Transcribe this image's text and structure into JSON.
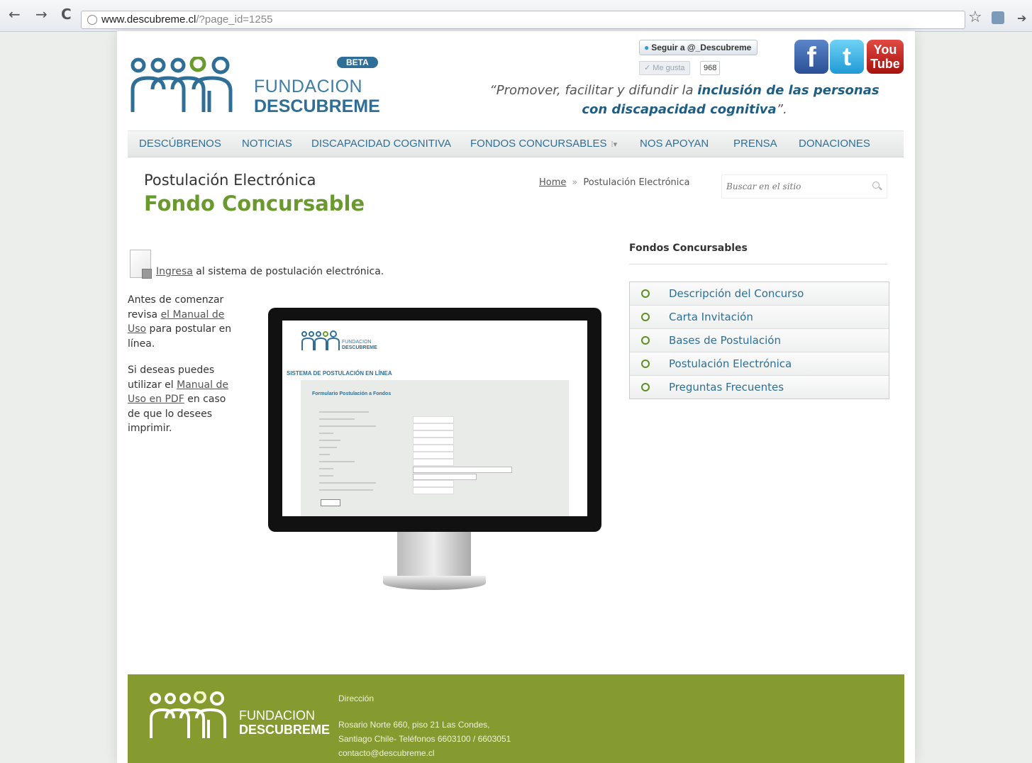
{
  "browser": {
    "url_host": "www.descubreme.cl",
    "url_path": "/?page_id=1255"
  },
  "header": {
    "logo_word1": "FUNDACION",
    "logo_word2": "DESCUBREME",
    "beta_badge": "BETA",
    "twitter_follow": "Seguir a @_Descubreme",
    "facebook_like": "Me gusta",
    "facebook_count": "968",
    "youtube_top": "You",
    "youtube_bottom": "Tube",
    "tagline_part1": "“Promover, facilitar y difundir la ",
    "tagline_highlight1": "inclusión de las personas",
    "tagline_highlight2": "con discapacidad cognitiva",
    "tagline_end": "”."
  },
  "menu": [
    {
      "label": "DESCÚBRENOS"
    },
    {
      "label": "NOTICIAS"
    },
    {
      "label": "DISCAPACIDAD COGNITIVA"
    },
    {
      "label": "FONDOS CONCURSABLES"
    },
    {
      "label": "NOS APOYAN"
    },
    {
      "label": "PRENSA"
    },
    {
      "label": "DONACIONES"
    }
  ],
  "page": {
    "title_line1": "Postulación Electrónica",
    "title_line2": "Fondo Concursable",
    "breadcrumb_home": "Home",
    "breadcrumb_sep": "»",
    "breadcrumb_current": "Postulación Electrónica",
    "search_placeholder": "Buscar en el sitio"
  },
  "content": {
    "ingresa_link": "Ingresa",
    "ingresa_rest": " al sistema de postulación electrónica.",
    "p1_before": "Antes de comenzar revisa ",
    "p1_link": "el Manual de Uso",
    "p1_after": " para postular en línea.",
    "p2_before": "Si deseas puedes utilizar el ",
    "p2_link": "Manual de Uso en PDF",
    "p2_after": " en caso de que lo desees imprimir.",
    "screen_title": "SISTEMA DE POSTULACIÓN EN LÍNEA",
    "screen_form_title": "Formulario Postulación a Fondos"
  },
  "sidebar": {
    "title": "Fondos Concursables",
    "items": [
      {
        "label": "Descripción del Concurso"
      },
      {
        "label": "Carta Invitación"
      },
      {
        "label": "Bases de Postulación"
      },
      {
        "label": "Postulación Electrónica"
      },
      {
        "label": "Preguntas Frecuentes"
      }
    ]
  },
  "footer": {
    "logo_word1": "FUNDACION",
    "logo_word2": "DESCUBREME",
    "heading": "Dirección",
    "address1": "Rosario Norte 660, piso 21 Las Condes,",
    "address2": "Santiago Chile- Teléfonos 6603100 / 6603051",
    "email": "contacto@descubreme.cl"
  },
  "colors": {
    "brand_blue": "#2f6e96",
    "brand_green": "#6a9a2e",
    "footer_green": "#869b2f"
  },
  "icons": [
    "back-icon",
    "forward-icon",
    "reload-icon",
    "globe-icon",
    "star-icon",
    "extension-icon",
    "twitter-bird-icon",
    "facebook-icon",
    "twitter-icon",
    "youtube-icon",
    "search-icon",
    "document-icon",
    "bullet-circle-icon"
  ]
}
